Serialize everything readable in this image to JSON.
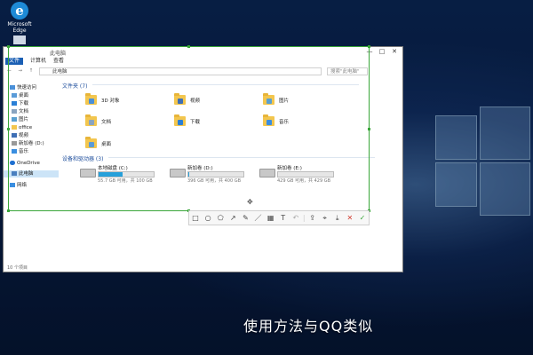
{
  "desktop": {
    "icons": [
      {
        "label": "Microsoft Edge",
        "icon": "edge-icon"
      },
      {
        "label": "...",
        "icon": "file-icon"
      }
    ]
  },
  "explorer": {
    "title": "此电脑",
    "ribbon_tabs": [
      "文件",
      "计算机",
      "查看"
    ],
    "address_path": "此电脑",
    "search_placeholder": "搜索\"此电脑\"",
    "nav": {
      "quick_access": "快速访问",
      "items": [
        "桌面",
        "下载",
        "文档",
        "图片",
        "office",
        "视频",
        "新加卷 (D:)",
        "音乐",
        "OneDrive",
        "此电脑",
        "网络"
      ]
    },
    "folders_header": "文件夹 (7)",
    "folders": [
      {
        "label": "3D 对象",
        "icon": "3d-objects-icon",
        "badge": "#4a90d9"
      },
      {
        "label": "视频",
        "icon": "videos-folder-icon",
        "badge": "#3f6fb5"
      },
      {
        "label": "图片",
        "icon": "pictures-folder-icon",
        "badge": "#5aa0d0"
      },
      {
        "label": "文档",
        "icon": "documents-folder-icon",
        "badge": "#8aa4c0"
      },
      {
        "label": "下载",
        "icon": "downloads-folder-icon",
        "badge": "#2a7fd6"
      },
      {
        "label": "音乐",
        "icon": "music-folder-icon",
        "badge": "#3a8ee0"
      },
      {
        "label": "桌面",
        "icon": "desktop-folder-icon",
        "badge": "#5a9bd8"
      }
    ],
    "drives_header": "设备和驱动器 (3)",
    "drives": [
      {
        "name": "本地磁盘 (C:)",
        "free": "55.7 GB 可用，共 100 GB",
        "used_fraction": 0.44
      },
      {
        "name": "新加卷 (D:)",
        "free": "396 GB 可用，共 400 GB",
        "used_fraction": 0.01
      },
      {
        "name": "新加卷 (E:)",
        "free": "429 GB 可用，共 429 GB",
        "used_fraction": 0.0
      }
    ],
    "status": "10 个项目"
  },
  "toolbar": {
    "tools": [
      {
        "name": "rectangle-tool-icon",
        "glyph": "□"
      },
      {
        "name": "ellipse-tool-icon",
        "glyph": "○"
      },
      {
        "name": "polygon-tool-icon",
        "glyph": "⬠"
      },
      {
        "name": "arrow-tool-icon",
        "glyph": "↗"
      },
      {
        "name": "pen-tool-icon",
        "glyph": "✎"
      },
      {
        "name": "marker-tool-icon",
        "glyph": "／"
      },
      {
        "name": "mosaic-tool-icon",
        "glyph": "▦"
      },
      {
        "name": "text-tool-icon",
        "glyph": "T"
      },
      {
        "name": "undo-icon",
        "glyph": "↶"
      },
      {
        "name": "share-icon",
        "glyph": "⇪"
      },
      {
        "name": "pin-icon",
        "glyph": "⌖"
      },
      {
        "name": "save-icon",
        "glyph": "⤓"
      },
      {
        "name": "cancel-icon",
        "glyph": "✕"
      },
      {
        "name": "confirm-icon",
        "glyph": "✓"
      }
    ]
  },
  "subtitle": "使用方法与QQ类似"
}
